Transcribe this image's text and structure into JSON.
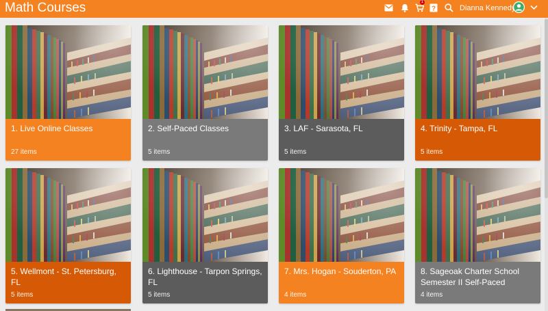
{
  "header": {
    "title": "Math Courses",
    "icons": [
      "mail-icon",
      "bell-icon",
      "cart-icon",
      "help-icon",
      "search-icon"
    ],
    "cart_badge": "1",
    "user_name": "Dianna Kennedy",
    "menu_icon": "chevron-down-icon"
  },
  "colors": {
    "brand": "#f58220",
    "orange_card": "#f58220",
    "dark_orange_card": "#d65a05",
    "gray_card": "#7a7a7a",
    "dark_gray_card": "#5c5c5c"
  },
  "cards": [
    {
      "title": "1. Live Online Classes",
      "count": "27 items",
      "color": "#f58220"
    },
    {
      "title": "2. Self-Paced Classes",
      "count": "5 items",
      "color": "#7a7a7a"
    },
    {
      "title": "3. LAF - Sarasota, FL",
      "count": "5 items",
      "color": "#5c5c5c"
    },
    {
      "title": "4. Trinity - Tampa, FL",
      "count": "5 items",
      "color": "#d65a05"
    },
    {
      "title": "5. Wellmont - St. Petersburg, FL",
      "count": "5 items",
      "color": "#d65a05"
    },
    {
      "title": "6. Lighthouse - Tarpon Springs, FL",
      "count": "5 items",
      "color": "#5c5c5c"
    },
    {
      "title": "7. Mrs. Hogan - Souderton, PA",
      "count": "4 items",
      "color": "#f58220"
    },
    {
      "title": "8. Sageoak Charter School Semester II Self-Paced",
      "count": "4 items",
      "color": "#7a7a7a"
    }
  ]
}
